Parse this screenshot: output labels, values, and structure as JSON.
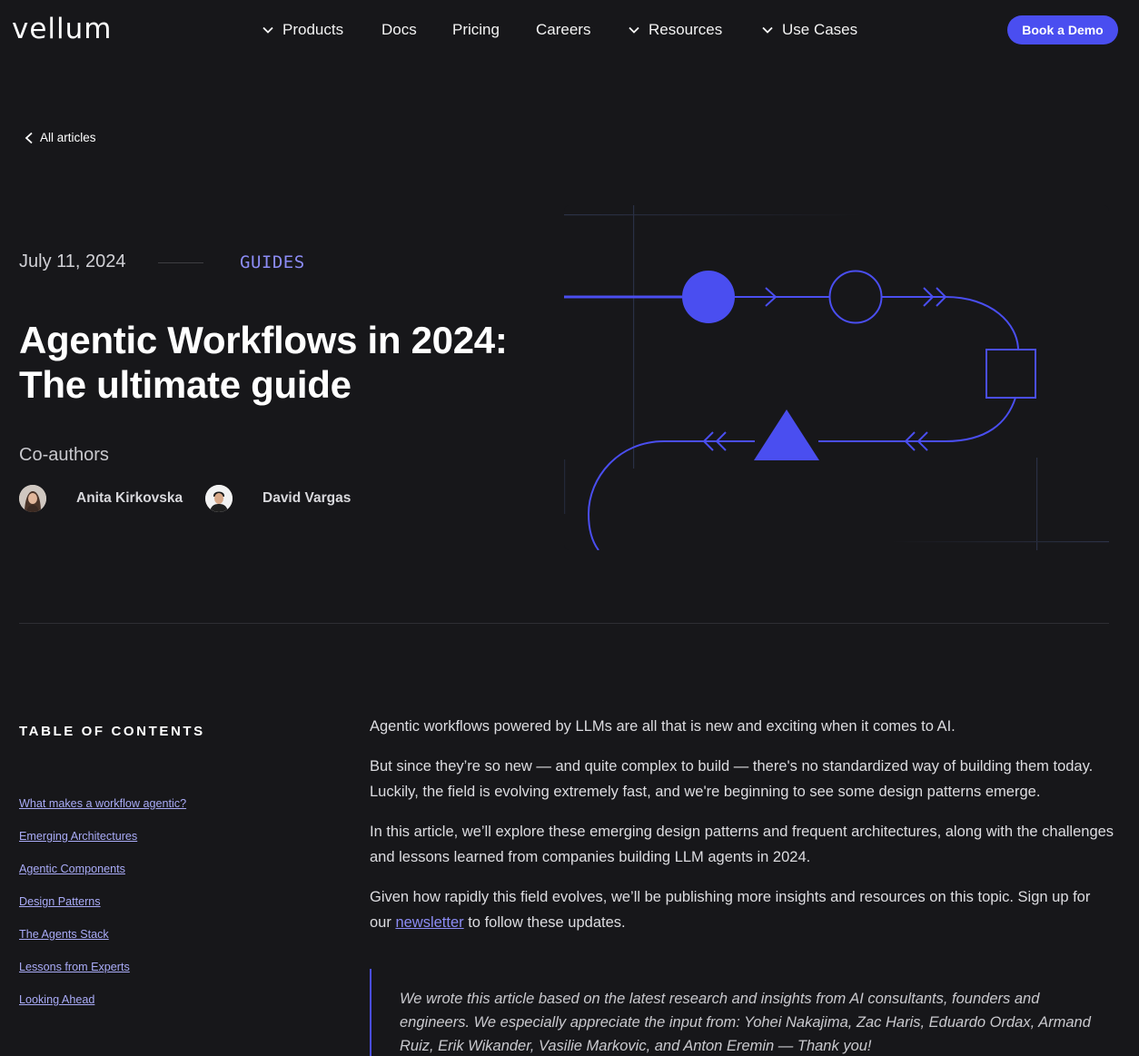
{
  "nav": {
    "logo": "vellum",
    "items": [
      {
        "label": "Products",
        "dropdown": true
      },
      {
        "label": "Docs",
        "dropdown": false
      },
      {
        "label": "Pricing",
        "dropdown": false
      },
      {
        "label": "Careers",
        "dropdown": false
      },
      {
        "label": "Resources",
        "dropdown": true
      },
      {
        "label": "Use Cases",
        "dropdown": true
      }
    ],
    "cta": "Book a Demo"
  },
  "back_link": "All articles",
  "hero": {
    "date": "July 11, 2024",
    "category": "GUIDES",
    "title": "Agentic Workflows in 2024: The ultimate guide",
    "coauthors_label": "Co-authors",
    "authors": [
      {
        "name": "Anita Kirkovska"
      },
      {
        "name": "David Vargas"
      }
    ]
  },
  "toc": {
    "title": "TABLE OF CONTENTS",
    "items": [
      "What makes a workflow agentic?",
      "Emerging Architectures",
      "Agentic Components",
      "Design Patterns",
      "The Agents Stack",
      "Lessons from Experts",
      "Looking Ahead"
    ]
  },
  "article": {
    "p1": "Agentic workflows powered by LLMs are all that is new and exciting when it comes to AI.",
    "p2": "But since they’re so new — and quite complex to build — there's no standardized way of building them today. Luckily, the field is evolving extremely fast, and we're beginning to see some design patterns emerge.",
    "p3": "In this article, we’ll explore these emerging design patterns and frequent architectures, along with the challenges and lessons learned from companies building LLM agents in 2024.",
    "p4_before": "Given how rapidly this field evolves, we’ll be publishing more insights and resources on this topic. Sign up for our ",
    "p4_link": "newsletter",
    "p4_after": " to follow these updates.",
    "quote": "We wrote this article based on the latest research and insights from AI consultants, founders and engineers. We especially appreciate the input from: Yohei Nakajima, Zac Haris, Eduardo Ordax, Armand Ruiz, Erik Wikander, Vasilie Markovic, and Anton Eremin — Thank you!"
  },
  "colors": {
    "background": "#17171a",
    "accent": "#4a4ef0",
    "link": "#a9abf7"
  },
  "icons": {
    "dropdown": "chevron-down-icon",
    "back": "chevron-left-icon"
  }
}
